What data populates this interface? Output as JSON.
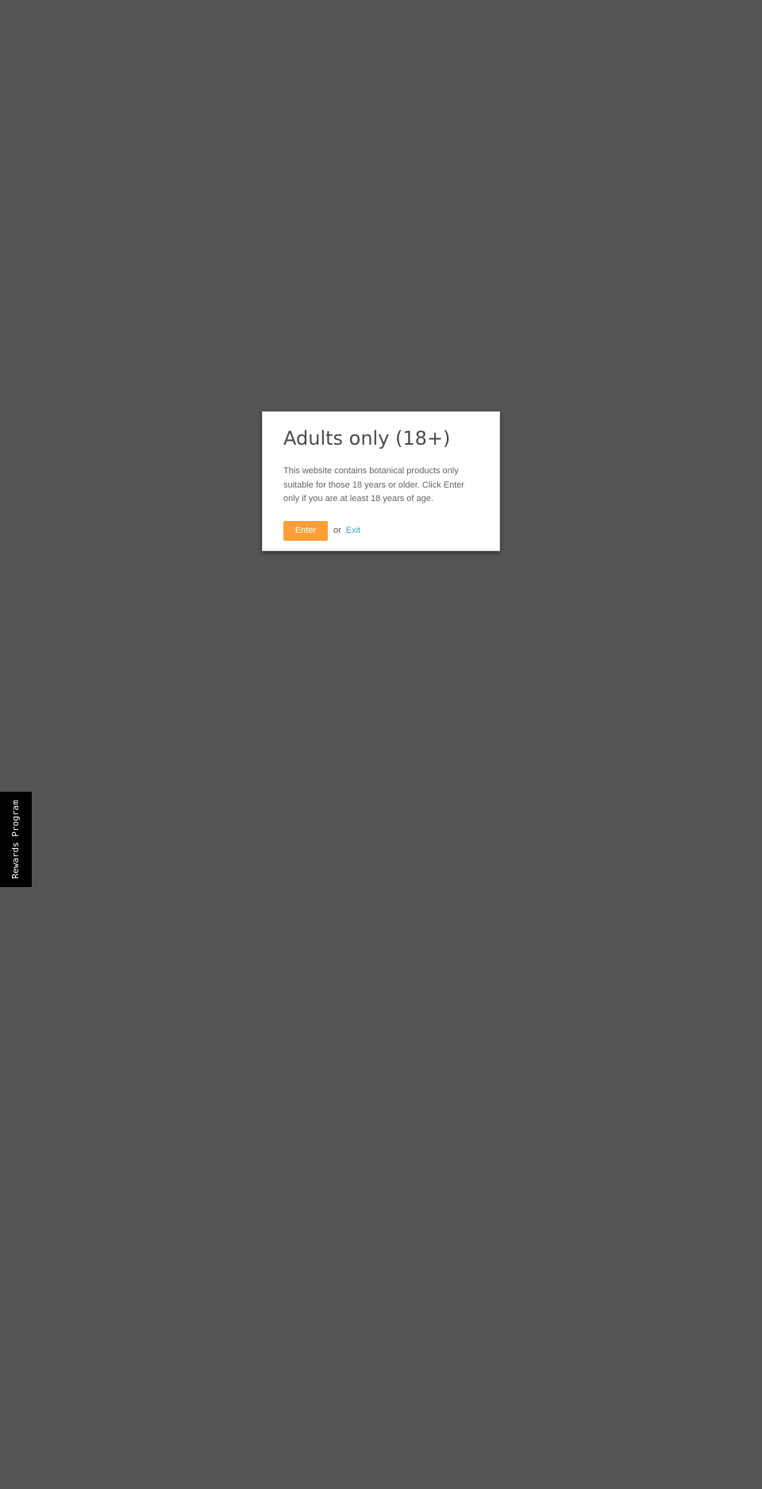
{
  "age_gate": {
    "title": "Adults only (18+)",
    "message": "This website contains botanical products only suitable for those 18 years or older. Click Enter only if you are at least 18 years of age.",
    "enter_label": "Enter",
    "or_text": "or",
    "exit_label": "Exit"
  },
  "rewards_tab": {
    "label": "Rewards Program"
  },
  "colors": {
    "overlay": "#555555",
    "modal_background": "#ffffff",
    "title_text": "#4a4a4a",
    "body_text": "#646464",
    "enter_button": "#ff9f35",
    "exit_link": "#38a9b4",
    "rewards_tab": "#000000"
  }
}
